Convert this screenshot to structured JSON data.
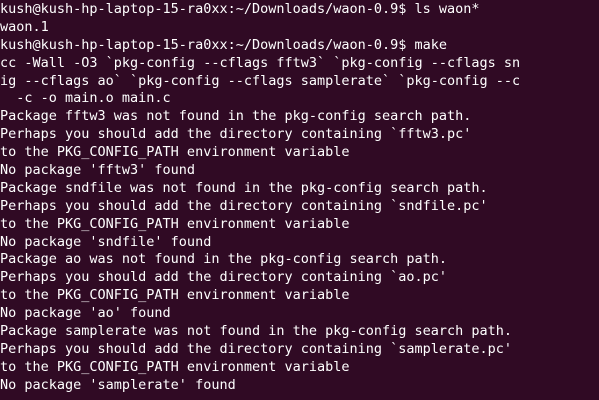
{
  "window": {
    "background": "#300a24",
    "foreground": "#ffffff"
  },
  "terminal": {
    "lines": [
      "kush@kush-hp-laptop-15-ra0xx:~/Downloads/waon-0.9$ ls waon*",
      "waon.1",
      "kush@kush-hp-laptop-15-ra0xx:~/Downloads/waon-0.9$ make",
      "cc -Wall -O3 `pkg-config --cflags fftw3` `pkg-config --cflags sn",
      "ig --cflags ao` `pkg-config --cflags samplerate` `pkg-config --c",
      "  -c -o main.o main.c",
      "Package fftw3 was not found in the pkg-config search path.",
      "Perhaps you should add the directory containing `fftw3.pc'",
      "to the PKG_CONFIG_PATH environment variable",
      "No package 'fftw3' found",
      "Package sndfile was not found in the pkg-config search path.",
      "Perhaps you should add the directory containing `sndfile.pc'",
      "to the PKG_CONFIG_PATH environment variable",
      "No package 'sndfile' found",
      "Package ao was not found in the pkg-config search path.",
      "Perhaps you should add the directory containing `ao.pc'",
      "to the PKG_CONFIG_PATH environment variable",
      "No package 'ao' found",
      "Package samplerate was not found in the pkg-config search path.",
      "Perhaps you should add the directory containing `samplerate.pc'",
      "to the PKG_CONFIG_PATH environment variable",
      "No package 'samplerate' found"
    ]
  }
}
